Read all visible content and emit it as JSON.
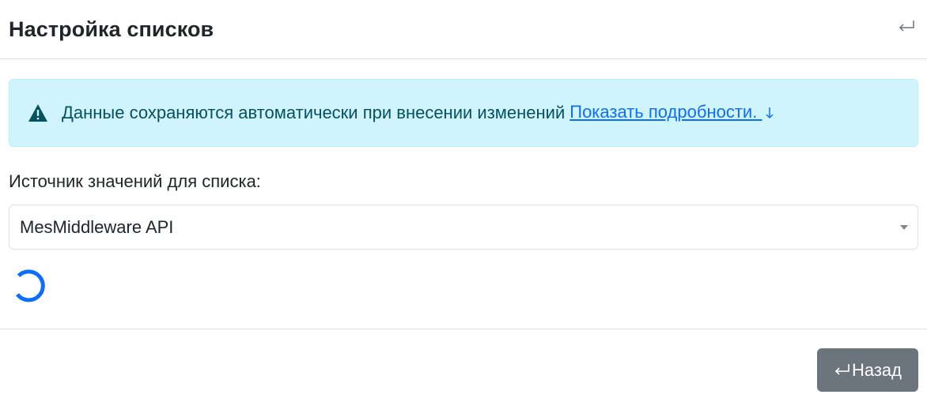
{
  "modal": {
    "title": "Настройка списков",
    "close_icon": "return-arrow-icon"
  },
  "alert": {
    "icon": "warning-triangle-icon",
    "text": "Данные сохраняются автоматически при внесении изменений",
    "link_label": "Показать подробности.",
    "link_icon": "arrow-down-icon",
    "colors": {
      "background": "#cff4fc",
      "text": "#055160",
      "link": "#0d6efd"
    }
  },
  "source": {
    "label": "Источник значений для списка:",
    "selected_value": "MesMiddleware API"
  },
  "loading": {
    "icon": "spinner-icon",
    "color": "#0d6efd"
  },
  "footer": {
    "back_label": "Назад",
    "back_icon": "return-arrow-icon",
    "back_color": "#6c757d"
  }
}
